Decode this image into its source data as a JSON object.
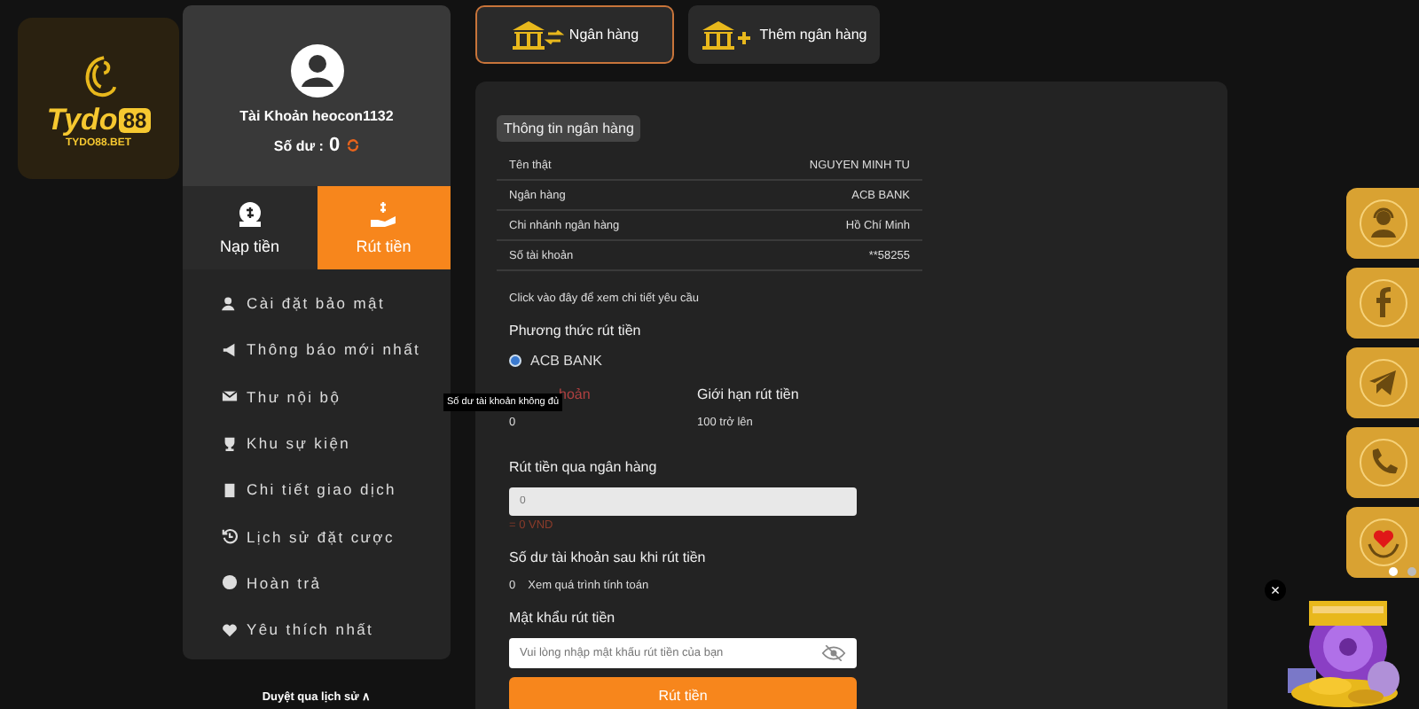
{
  "logo": {
    "word": "Tydo",
    "number": "88",
    "domain": "TYDO88.BET"
  },
  "account": {
    "name": "Tài Khoản heocon1132",
    "balance_label": "Số dư :",
    "balance": "0"
  },
  "actions": [
    {
      "label": "Nạp tiền",
      "kind": "deposit",
      "selected": false
    },
    {
      "label": "Rút tiền",
      "kind": "withdraw",
      "selected": true
    }
  ],
  "menu": [
    {
      "label": "Cài đặt bảo mật",
      "kind": "security"
    },
    {
      "label": "Thông báo mới nhất",
      "kind": "notice"
    },
    {
      "label": "Thư nội bộ",
      "kind": "mail"
    },
    {
      "label": "Khu sự kiện",
      "kind": "trophy"
    },
    {
      "label": "Chi tiết giao dịch",
      "kind": "clipboard"
    },
    {
      "label": "Lịch sử đặt cược",
      "kind": "history"
    },
    {
      "label": "Hoàn trả",
      "kind": "coin"
    },
    {
      "label": "Yêu thích nhất",
      "kind": "heart"
    }
  ],
  "history_link": "Duyệt qua lịch sử ∧",
  "tooltip": "Số dư tài khoản không đủ",
  "tabs": [
    {
      "label": "Ngân hàng",
      "kind": "bank",
      "selected": true
    },
    {
      "label": "Thêm ngân hàng",
      "kind": "add",
      "selected": false
    }
  ],
  "bank_info": {
    "title": "Thông tin ngân hàng",
    "rows": [
      {
        "label": "Tên thật",
        "value": "NGUYEN MINH TU"
      },
      {
        "label": "Ngân hàng",
        "value": "ACB BANK"
      },
      {
        "label": "Chi nhánh ngân hàng",
        "value": "Hồ Chí Minh"
      },
      {
        "label": "Số tài khoản",
        "value": "**58255"
      }
    ],
    "details_link": "Click vào đây để xem chi tiết yêu cầu"
  },
  "method": {
    "title": "Phương thức rút tiền",
    "options": [
      {
        "label": "ACB BANK",
        "selected": true
      }
    ]
  },
  "balance_col": {
    "label": "hoản",
    "value": "0"
  },
  "limit_col": {
    "label": "Giới hạn rút tiền",
    "value": "100 trở lên"
  },
  "amount": {
    "label": "Rút tiền qua ngân hàng",
    "placeholder": "0",
    "converted": "= 0 VND"
  },
  "after": {
    "label": "Số dư tài khoản sau khi rút tiền",
    "value": "0",
    "link": "Xem quá trình tính toán"
  },
  "password": {
    "label": "Mật khẩu rút tiền",
    "placeholder": "Vui lòng nhập mật khẩu rút tiền của bạn"
  },
  "submit": "Rút tiền",
  "side_buttons": [
    {
      "kind": "support"
    },
    {
      "kind": "facebook"
    },
    {
      "kind": "telegram"
    },
    {
      "kind": "phone"
    },
    {
      "kind": "heart"
    }
  ],
  "close": "×"
}
